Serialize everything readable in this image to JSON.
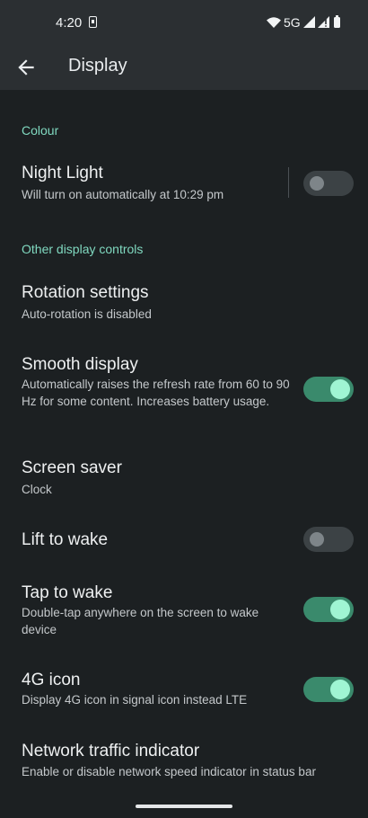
{
  "status_bar": {
    "time": "4:20",
    "network": "5G"
  },
  "app_bar": {
    "title": "Display",
    "back_icon": "arrow-back-icon"
  },
  "sections": {
    "colour": "Colour",
    "other": "Other display controls"
  },
  "settings": {
    "night_light": {
      "title": "Night Light",
      "summary": "Will turn on automatically at 10:29 pm",
      "enabled": false
    },
    "rotation": {
      "title": "Rotation settings",
      "summary": "Auto-rotation is disabled"
    },
    "smooth_display": {
      "title": "Smooth display",
      "summary": "Automatically raises the refresh rate from 60 to 90 Hz for some content. Increases battery usage.",
      "enabled": true
    },
    "screen_saver": {
      "title": "Screen saver",
      "summary": "Clock"
    },
    "lift_to_wake": {
      "title": "Lift to wake",
      "enabled": false
    },
    "tap_to_wake": {
      "title": "Tap to wake",
      "summary": "Double-tap anywhere on the screen to wake device",
      "enabled": true
    },
    "icon_4g": {
      "title": "4G icon",
      "summary": "Display 4G icon in signal icon instead LTE",
      "enabled": true
    },
    "network_traffic": {
      "title": "Network traffic indicator",
      "summary": "Enable or disable network speed indicator in status bar"
    }
  },
  "colors": {
    "accent": "#80d9c0",
    "toggle_on_track": "#3a8a6c",
    "toggle_on_knob": "#9ff5d3",
    "background": "#1c2022"
  }
}
